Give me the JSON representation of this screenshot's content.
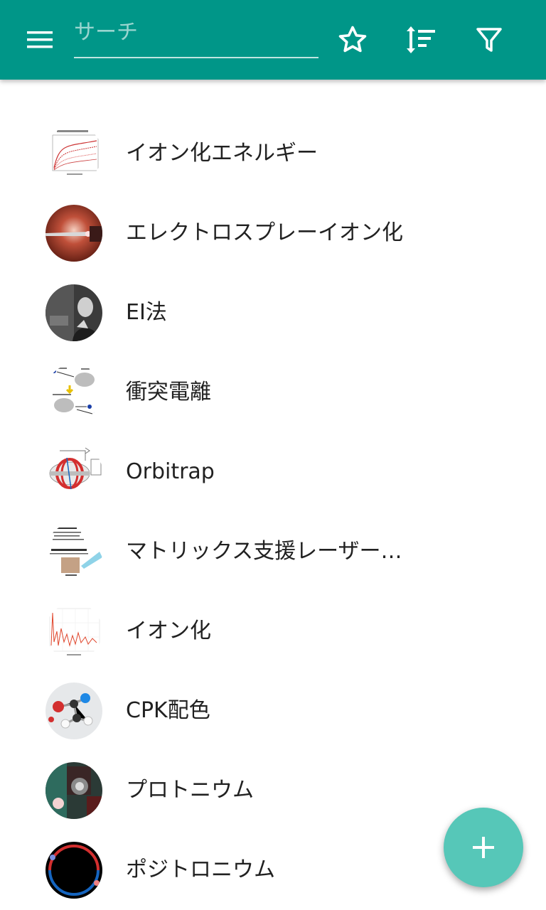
{
  "toolbar": {
    "menu_icon": "menu-icon",
    "search": {
      "placeholder": "サーチ",
      "value": ""
    },
    "favorite_icon": "star-outline-icon",
    "sort_icon": "sort-icon",
    "filter_icon": "filter-icon",
    "background_color": "#009688"
  },
  "list": {
    "items": [
      {
        "label": "イオン化エネルギー",
        "thumbnail": "ionization-energy-chart"
      },
      {
        "label": "エレクトロスプレーイオン化",
        "thumbnail": "electrospray-photo"
      },
      {
        "label": "EI法",
        "thumbnail": "portrait-photo"
      },
      {
        "label": "衝突電離",
        "thumbnail": "impact-ionization-diagram"
      },
      {
        "label": "Orbitrap",
        "thumbnail": "orbitrap-diagram"
      },
      {
        "label": "マトリックス支援レーザー…",
        "thumbnail": "maldi-diagram"
      },
      {
        "label": "イオン化",
        "thumbnail": "ionization-spectrum"
      },
      {
        "label": "CPK配色",
        "thumbnail": "molecule-model"
      },
      {
        "label": "プロトニウム",
        "thumbnail": "protonium-photo"
      },
      {
        "label": "ポジトロニウム",
        "thumbnail": "positronium-diagram"
      }
    ]
  },
  "fab": {
    "icon": "plus-icon",
    "color": "#56c7b8"
  }
}
